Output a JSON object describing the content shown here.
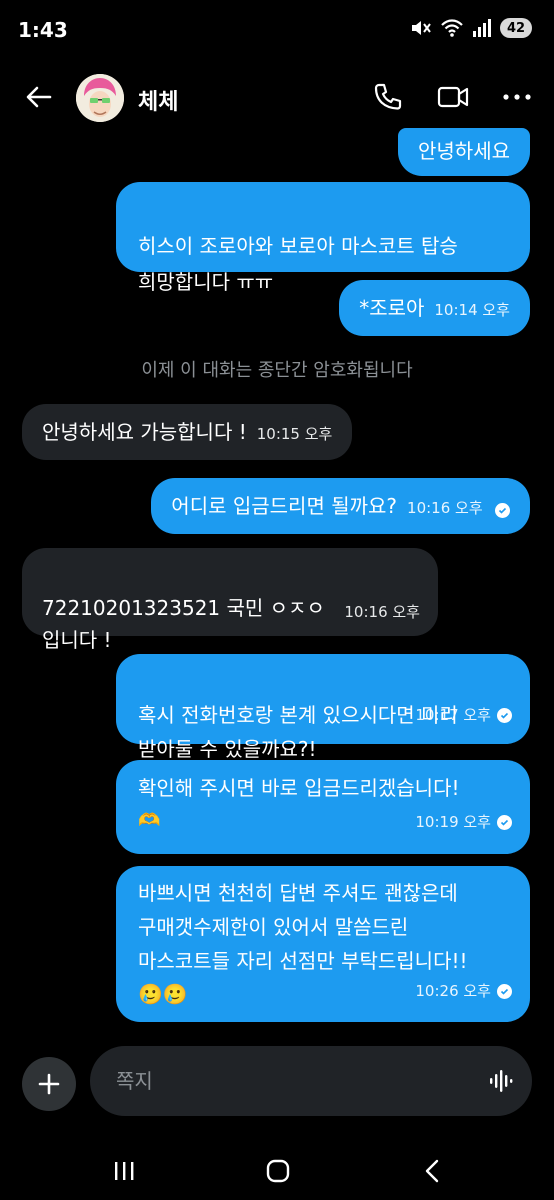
{
  "status": {
    "time": "1:43",
    "battery": "42"
  },
  "header": {
    "name": "체체"
  },
  "messages": [
    {
      "text": "안녕하세요"
    },
    {
      "text": "히스이 조로아와 보로아 마스코트 탑승\n희망합니다 ㅠㅠ"
    },
    {
      "text": "*조로아",
      "time": "10:14 오후"
    },
    {
      "text": "안녕하세요 가능합니다 !",
      "time": "10:15 오후"
    },
    {
      "text": "어디로 입금드리면 될까요?",
      "time": "10:16 오후"
    },
    {
      "text": "72210201323521 국민 ㅇㅈㅇ\n입니다 !",
      "time": "10:16 오후"
    },
    {
      "text": "혹시 전화번호랑 본계 있으시다면 미리\n받아둘 수 있을까요?!",
      "time": "10:17 오후"
    },
    {
      "text": "확인해 주시면 바로 입금드리겠습니다!",
      "emoji": "🫶",
      "time": "10:19 오후"
    },
    {
      "text": "바쁘시면 천천히 답변 주셔도 괜찮은데\n구매갯수제한이 있어서 말씀드린\n마스코트들 자리 선점만 부탁드립니다!!",
      "emoji": "🥲🥲",
      "time": "10:26 오후"
    }
  ],
  "notice": "이제 이 대화는 종단간 암호화됩니다",
  "composer": {
    "placeholder": "쪽지"
  },
  "colors": {
    "accent": "#1d9bf0",
    "incoming": "#202327",
    "background": "#000000"
  },
  "icons": {
    "back": "back-arrow-icon",
    "call": "phone-icon",
    "video": "video-icon",
    "more": "more-icon",
    "add": "plus-icon",
    "voice": "voice-icon",
    "nav_recents": "recents-icon",
    "nav_home": "home-icon",
    "nav_back": "nav-back-icon"
  }
}
